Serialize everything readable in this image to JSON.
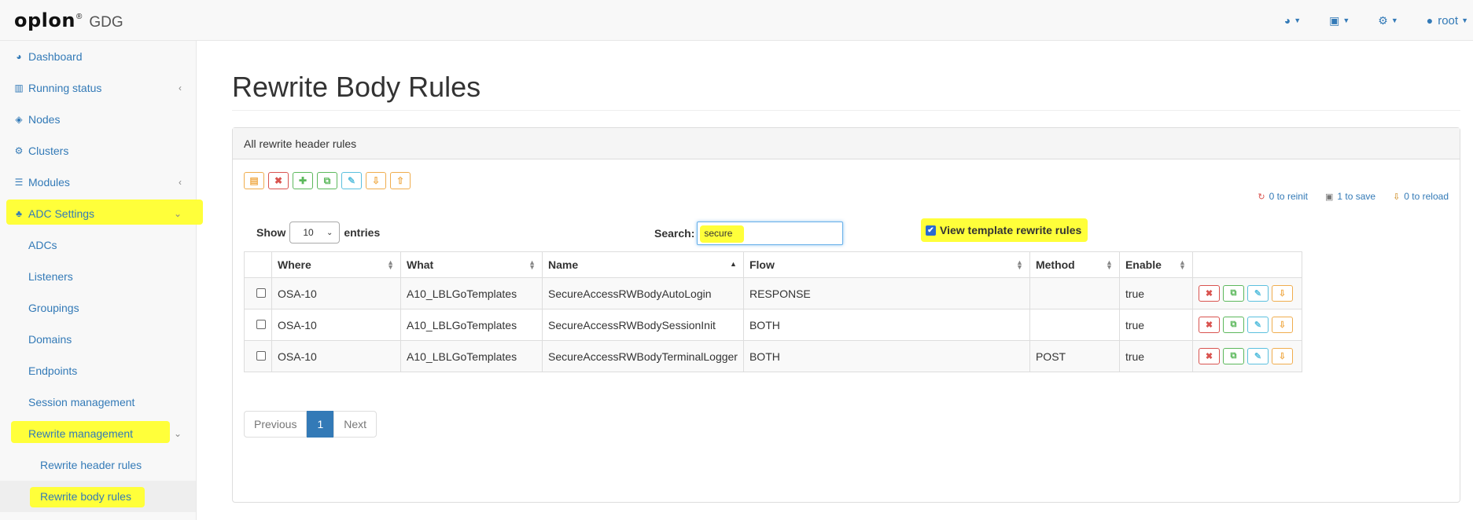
{
  "brand": {
    "logo": "oplon",
    "registered": "®",
    "product": "GDG"
  },
  "topnav": {
    "items": [
      {
        "icon": "dashboard-icon",
        "glyph": "◕",
        "label": ""
      },
      {
        "icon": "save-icon",
        "glyph": "💾",
        "label": ""
      },
      {
        "icon": "gear-icon",
        "glyph": "⚙",
        "label": ""
      },
      {
        "icon": "user-icon",
        "glyph": "👤",
        "label": "root"
      }
    ]
  },
  "sidebar": {
    "items": [
      {
        "label": "Dashboard",
        "icon": "dashboard-icon"
      },
      {
        "label": "Running status",
        "icon": "bar-chart-icon"
      },
      {
        "label": "Nodes",
        "icon": "cube-icon"
      },
      {
        "label": "Clusters",
        "icon": "cogs-icon"
      },
      {
        "label": "Modules",
        "icon": "list-icon"
      },
      {
        "label": "ADC Settings",
        "icon": "sitemap-icon"
      }
    ],
    "adc_subitems": [
      {
        "label": "ADCs"
      },
      {
        "label": "Listeners"
      },
      {
        "label": "Groupings"
      },
      {
        "label": "Domains"
      },
      {
        "label": "Endpoints"
      },
      {
        "label": "Session management"
      },
      {
        "label": "Rewrite management"
      }
    ],
    "rewrite_subitems": [
      {
        "label": "Rewrite header rules"
      },
      {
        "label": "Rewrite body rules"
      }
    ]
  },
  "page": {
    "title": "Rewrite Body Rules"
  },
  "panel": {
    "heading": "All rewrite header rules",
    "status": {
      "reinit": "0 to reinit",
      "save": "1 to save",
      "reload": "0 to reload"
    },
    "length": {
      "show": "Show",
      "value": "10",
      "entries": "entries"
    },
    "search": {
      "label": "Search:",
      "value": "secure"
    },
    "template_toggle": {
      "label": "View template rewrite rules",
      "checked": true
    }
  },
  "table": {
    "columns": [
      "",
      "Where",
      "What",
      "Name",
      "Flow",
      "Method",
      "Enable",
      ""
    ],
    "rows": [
      {
        "where": "OSA-10",
        "what": "A10_LBLGoTemplates",
        "name": "SecureAccessRWBodyAutoLogin",
        "flow": "RESPONSE",
        "method": "",
        "enable": "true"
      },
      {
        "where": "OSA-10",
        "what": "A10_LBLGoTemplates",
        "name": "SecureAccessRWBodySessionInit",
        "flow": "BOTH",
        "method": "",
        "enable": "true"
      },
      {
        "where": "OSA-10",
        "what": "A10_LBLGoTemplates",
        "name": "SecureAccessRWBodyTerminalLogger",
        "flow": "BOTH",
        "method": "POST",
        "enable": "true"
      }
    ]
  },
  "pagination": {
    "previous": "Previous",
    "current": "1",
    "next": "Next"
  },
  "colors": {
    "link": "#337ab7",
    "highlight": "#ffff3a",
    "danger": "#d9534f",
    "success": "#5cb85c",
    "info": "#5bc0de",
    "warning": "#f0ad4e"
  }
}
